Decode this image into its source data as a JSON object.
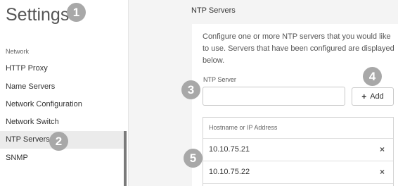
{
  "sidebar": {
    "title": "Settings",
    "section_label": "Network",
    "items": [
      {
        "label": "HTTP Proxy"
      },
      {
        "label": "Name Servers"
      },
      {
        "label": "Network Configuration"
      },
      {
        "label": "Network Switch"
      },
      {
        "label": "NTP Servers",
        "active": true
      },
      {
        "label": "SNMP"
      }
    ]
  },
  "main": {
    "title": "NTP Servers",
    "description": "Configure one or more NTP servers that you would like to use. Servers that have been configured are displayed below.",
    "field_label": "NTP Server",
    "input_value": "",
    "add_button_icon": "+",
    "add_button_label": "Add",
    "table": {
      "header": "Hostname or IP Address",
      "rows": [
        {
          "address": "10.10.75.21",
          "remove_icon": "×"
        },
        {
          "address": "10.10.75.22",
          "remove_icon": "×"
        }
      ]
    }
  },
  "callouts": [
    "1",
    "2",
    "3",
    "4",
    "5"
  ]
}
